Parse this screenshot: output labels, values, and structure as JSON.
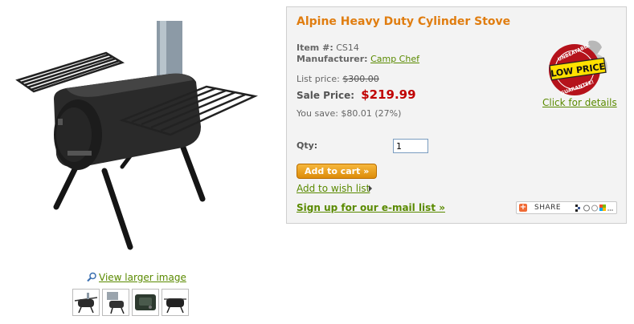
{
  "product": {
    "title": "Alpine Heavy Duty Cylinder Stove",
    "item_label": "Item #:",
    "item_value": "CS14",
    "manufacturer_label": "Manufacturer:",
    "manufacturer_value": "Camp Chef",
    "list_price_label": "List price:",
    "list_price_value": "$300.00",
    "sale_price_label": "Sale Price:",
    "sale_price_value": "$219.99",
    "you_save_text": "You save: $80.01 (27%)"
  },
  "purchase": {
    "qty_label": "Qty:",
    "qty_value": "1",
    "add_to_cart_label": "Add to cart »",
    "wish_list_label": "Add to wish list",
    "email_signup_label": "Sign up for our e-mail list »"
  },
  "badge": {
    "top_text": "UNBEATABLE",
    "center_text": "LOW PRICE",
    "bottom_text": "GUARANTEE!",
    "details_label": "Click for details"
  },
  "share": {
    "label": "SHARE"
  },
  "gallery": {
    "view_larger_label": "View larger image",
    "thumbnail_count": 4
  },
  "colors": {
    "title": "#e07d10",
    "sale_price": "#c00000",
    "link": "#5a8a00",
    "button": "#f0a020"
  }
}
